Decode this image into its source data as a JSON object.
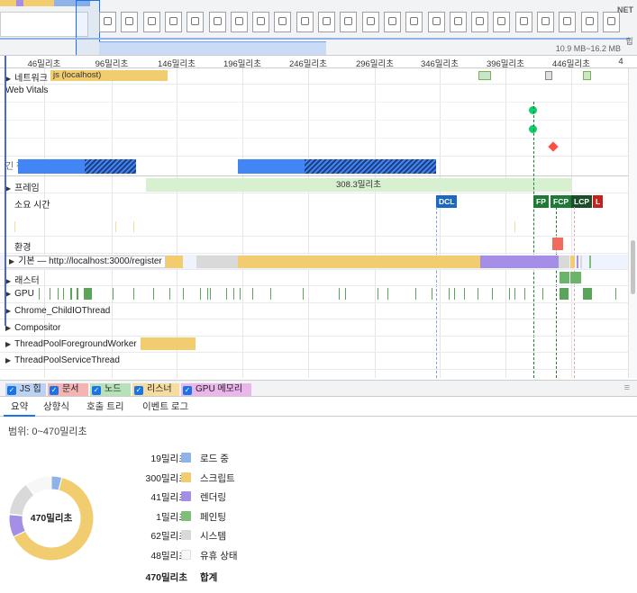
{
  "overview": {
    "net_label": "NET",
    "memory_range": "10.9 MB~16.2 MB",
    "heap_label": "힙"
  },
  "ruler": {
    "ticks": [
      "46밀리초",
      "96밀리초",
      "146밀리초",
      "196밀리초",
      "246밀리초",
      "296밀리초",
      "346밀리초",
      "396밀리초",
      "446밀리초",
      "4"
    ]
  },
  "tracks": {
    "network": {
      "label": "네트워크",
      "bar_label": "js (localhost)"
    },
    "web_vitals": {
      "label": "Web Vitals"
    },
    "long_tasks": {
      "label": "긴 작업"
    },
    "frames": {
      "label": "프레임",
      "bar_label": "308.3밀리초"
    },
    "timings": {
      "label": "소요 시간",
      "markers": {
        "dcl": "DCL",
        "fp": "FP",
        "fcp": "FCP",
        "lcp": "LCP",
        "l": "L"
      }
    },
    "environment": {
      "label": "환경"
    },
    "main": {
      "label": "기본 — http://localhost:3000/register"
    },
    "raster": {
      "label": "래스터"
    },
    "gpu": {
      "label": "GPU"
    },
    "child_io": {
      "label": "Chrome_ChildIOThread"
    },
    "compositor": {
      "label": "Compositor"
    },
    "pool_fg": {
      "label": "ThreadPoolForegroundWorker"
    },
    "pool_svc": {
      "label": "ThreadPoolServiceThread"
    }
  },
  "legend": [
    {
      "label": "JS 힙",
      "color": "#bcd2f5"
    },
    {
      "label": "문서",
      "color": "#f4b4b4"
    },
    {
      "label": "노드",
      "color": "#b7e1b8"
    },
    {
      "label": "리스너",
      "color": "#f7dca0"
    },
    {
      "label": "GPU 메모리",
      "color": "#ebb6ec"
    }
  ],
  "bottom_tabs": [
    "요약",
    "상향식",
    "호출 트리",
    "이벤트 로그"
  ],
  "summary": {
    "range": "범위: 0~470밀리초",
    "center_label": "470밀리초",
    "rows": [
      {
        "value": "19밀리초",
        "label": "로드 중",
        "color": "#8fb2e8",
        "ms": 19
      },
      {
        "value": "300밀리초",
        "label": "스크립트",
        "color": "#f2cd6f",
        "ms": 300
      },
      {
        "value": "41밀리초",
        "label": "렌더링",
        "color": "#a58ee6",
        "ms": 41
      },
      {
        "value": "1밀리초",
        "label": "페인팅",
        "color": "#80be79",
        "ms": 1
      },
      {
        "value": "62밀리초",
        "label": "시스템",
        "color": "#d9d9d9",
        "ms": 62
      },
      {
        "value": "48밀리초",
        "label": "유휴 상태",
        "color": "#f7f7f7",
        "ms": 48
      }
    ],
    "total_value": "470밀리초",
    "total_label": "합계"
  }
}
